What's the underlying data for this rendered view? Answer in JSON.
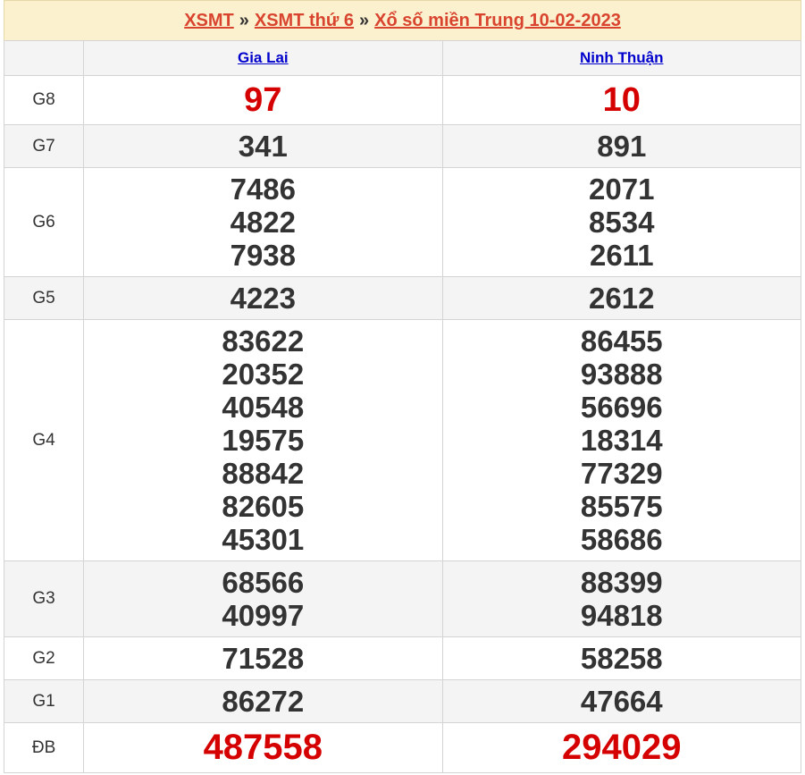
{
  "breadcrumb": {
    "item1": "XSMT",
    "item2": "XSMT thứ 6",
    "item3": "Xổ số miền Trung 10-02-2023",
    "separator": "»"
  },
  "columns": [
    "Gia Lai",
    "Ninh Thuận"
  ],
  "prizes": [
    {
      "label": "G8",
      "values": [
        [
          "97"
        ],
        [
          "10"
        ]
      ]
    },
    {
      "label": "G7",
      "values": [
        [
          "341"
        ],
        [
          "891"
        ]
      ]
    },
    {
      "label": "G6",
      "values": [
        [
          "7486",
          "4822",
          "7938"
        ],
        [
          "2071",
          "8534",
          "2611"
        ]
      ]
    },
    {
      "label": "G5",
      "values": [
        [
          "4223"
        ],
        [
          "2612"
        ]
      ]
    },
    {
      "label": "G4",
      "values": [
        [
          "83622",
          "20352",
          "40548",
          "19575",
          "88842",
          "82605",
          "45301"
        ],
        [
          "86455",
          "93888",
          "56696",
          "18314",
          "77329",
          "85575",
          "58686"
        ]
      ]
    },
    {
      "label": "G3",
      "values": [
        [
          "68566",
          "40997"
        ],
        [
          "88399",
          "94818"
        ]
      ]
    },
    {
      "label": "G2",
      "values": [
        [
          "71528"
        ],
        [
          "58258"
        ]
      ]
    },
    {
      "label": "G1",
      "values": [
        [
          "86272"
        ],
        [
          "47664"
        ]
      ]
    },
    {
      "label": "ĐB",
      "values": [
        [
          "487558"
        ],
        [
          "294029"
        ]
      ]
    }
  ],
  "colors": {
    "accent": "#d9442f",
    "prize_red": "#d50000",
    "link": "#0000cc",
    "title_bg": "#fcf1cf"
  }
}
